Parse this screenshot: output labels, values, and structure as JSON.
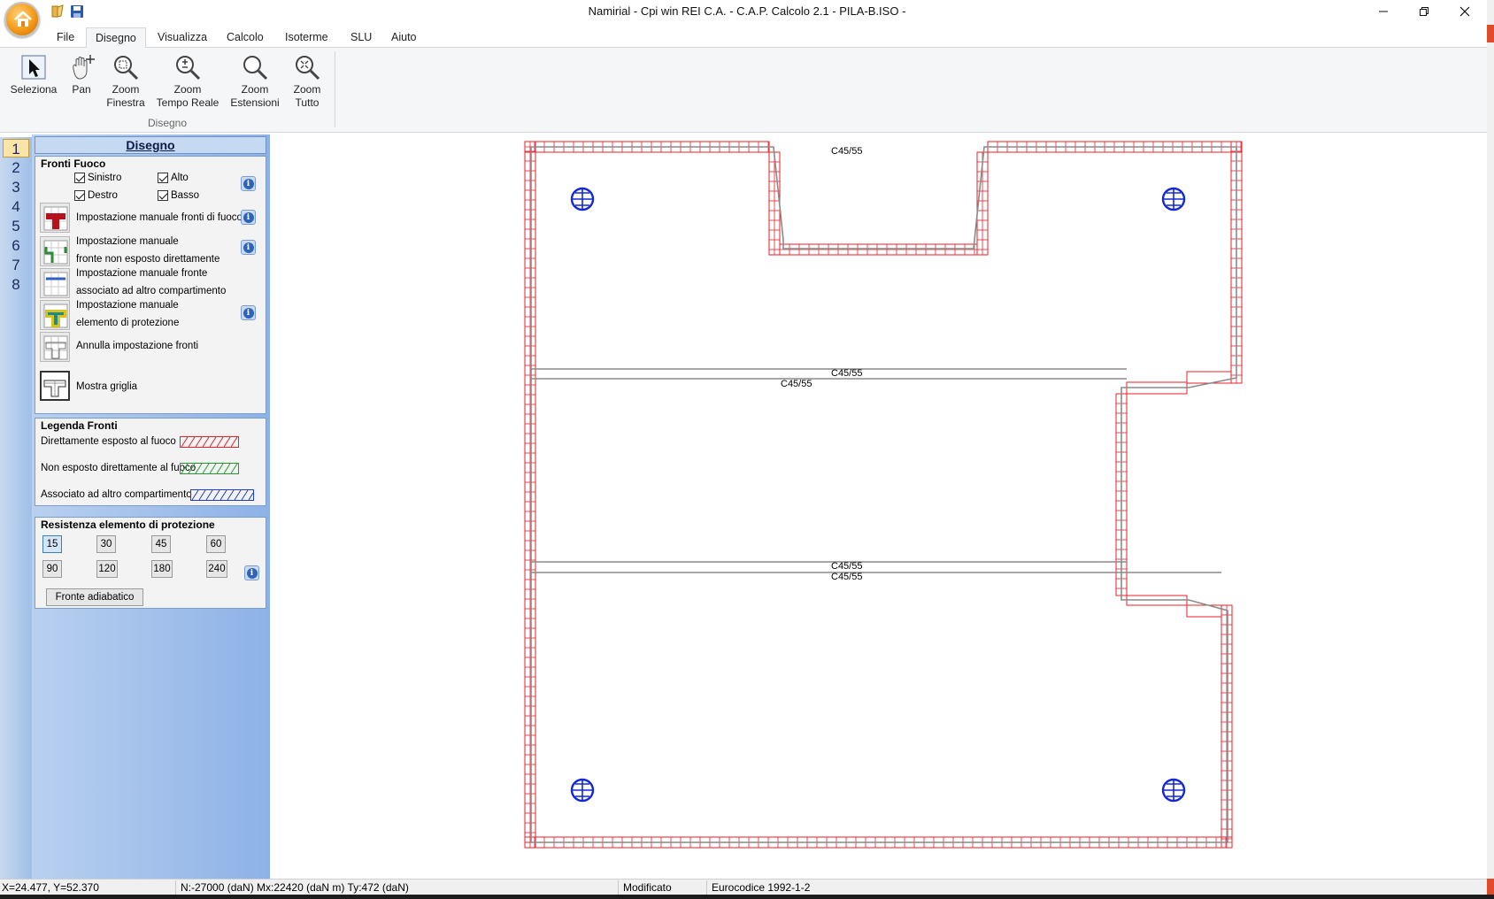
{
  "window": {
    "title": "Namirial - Cpi win REI C.A. -  C.A.P. Calcolo 2.1 - PILA-B.ISO -"
  },
  "ribbon": {
    "tabs": [
      "File",
      "Disegno",
      "Visualizza",
      "Calcolo",
      "Isoterme",
      "SLU",
      "Aiuto"
    ],
    "active_tab": "Disegno",
    "buttons": [
      {
        "line1": "Seleziona",
        "line2": "",
        "icon": "cursor-arrow-icon"
      },
      {
        "line1": "Pan",
        "line2": "",
        "icon": "pan-hand-icon"
      },
      {
        "line1": "Zoom",
        "line2": "Finestra",
        "icon": "zoom-window-icon"
      },
      {
        "line1": "Zoom",
        "line2": "Tempo Reale",
        "icon": "zoom-realtime-icon"
      },
      {
        "line1": "Zoom",
        "line2": "Estensioni",
        "icon": "zoom-extents-icon"
      },
      {
        "line1": "Zoom",
        "line2": "Tutto",
        "icon": "zoom-all-icon"
      }
    ],
    "group_label": "Disegno"
  },
  "vertical_tabs": [
    "1",
    "2",
    "3",
    "4",
    "5",
    "6",
    "7",
    "8"
  ],
  "panel": {
    "title": "Disegno",
    "fronti_fuoco": {
      "title": "Fronti Fuoco",
      "checkboxes": [
        {
          "label": "Sinistro",
          "checked": true
        },
        {
          "label": "Alto",
          "checked": true
        },
        {
          "label": "Destro",
          "checked": true
        },
        {
          "label": "Basso",
          "checked": true
        }
      ],
      "tools": [
        {
          "line1": "Impostazione manuale fronti di fuoco",
          "line2": "",
          "color": "#b5121b"
        },
        {
          "line1": "Impostazione manuale",
          "line2": "fronte non esposto direttamente",
          "color": "#2e8b3a"
        },
        {
          "line1": "Impostazione manuale fronte",
          "line2": "associato ad altro compartimento",
          "color": "#2f5fc4"
        },
        {
          "line1": "Impostazione manuale",
          "line2": "elemento di protezione",
          "color": "#d8c21f"
        },
        {
          "line1": "Annulla impostazione fronti",
          "line2": "",
          "color": "#9a9a9a"
        }
      ],
      "show_grid": "Mostra griglia"
    },
    "legenda": {
      "title": "Legenda Fronti",
      "items": [
        {
          "label": "Direttamente esposto al fuoco",
          "color": "#e8202a"
        },
        {
          "label": "Non esposto direttamente al fuoco",
          "color": "#1f9a2e"
        },
        {
          "label": "Associato ad altro compartimento",
          "color": "#1f3fd0"
        }
      ]
    },
    "resistenza": {
      "title": "Resistenza elemento di protezione",
      "values": [
        "15",
        "30",
        "45",
        "60",
        "90",
        "120",
        "180",
        "240"
      ],
      "selected": "15",
      "adiabatic_button": "Fronte adiabatico"
    }
  },
  "drawing": {
    "labels": [
      "C45/55",
      "C45/55",
      "C45/55",
      "C45/55",
      "C45/55"
    ],
    "fire_color": "#e8202a",
    "rebar_color": "#1428d8"
  },
  "status": {
    "coords": "X=24.477, Y=52.370",
    "forces": "N:-27000 (daN) Mx:22420 (daN m) Ty:472 (daN)",
    "state": "Modificato",
    "code": "Eurocodice 1992-1-2"
  }
}
